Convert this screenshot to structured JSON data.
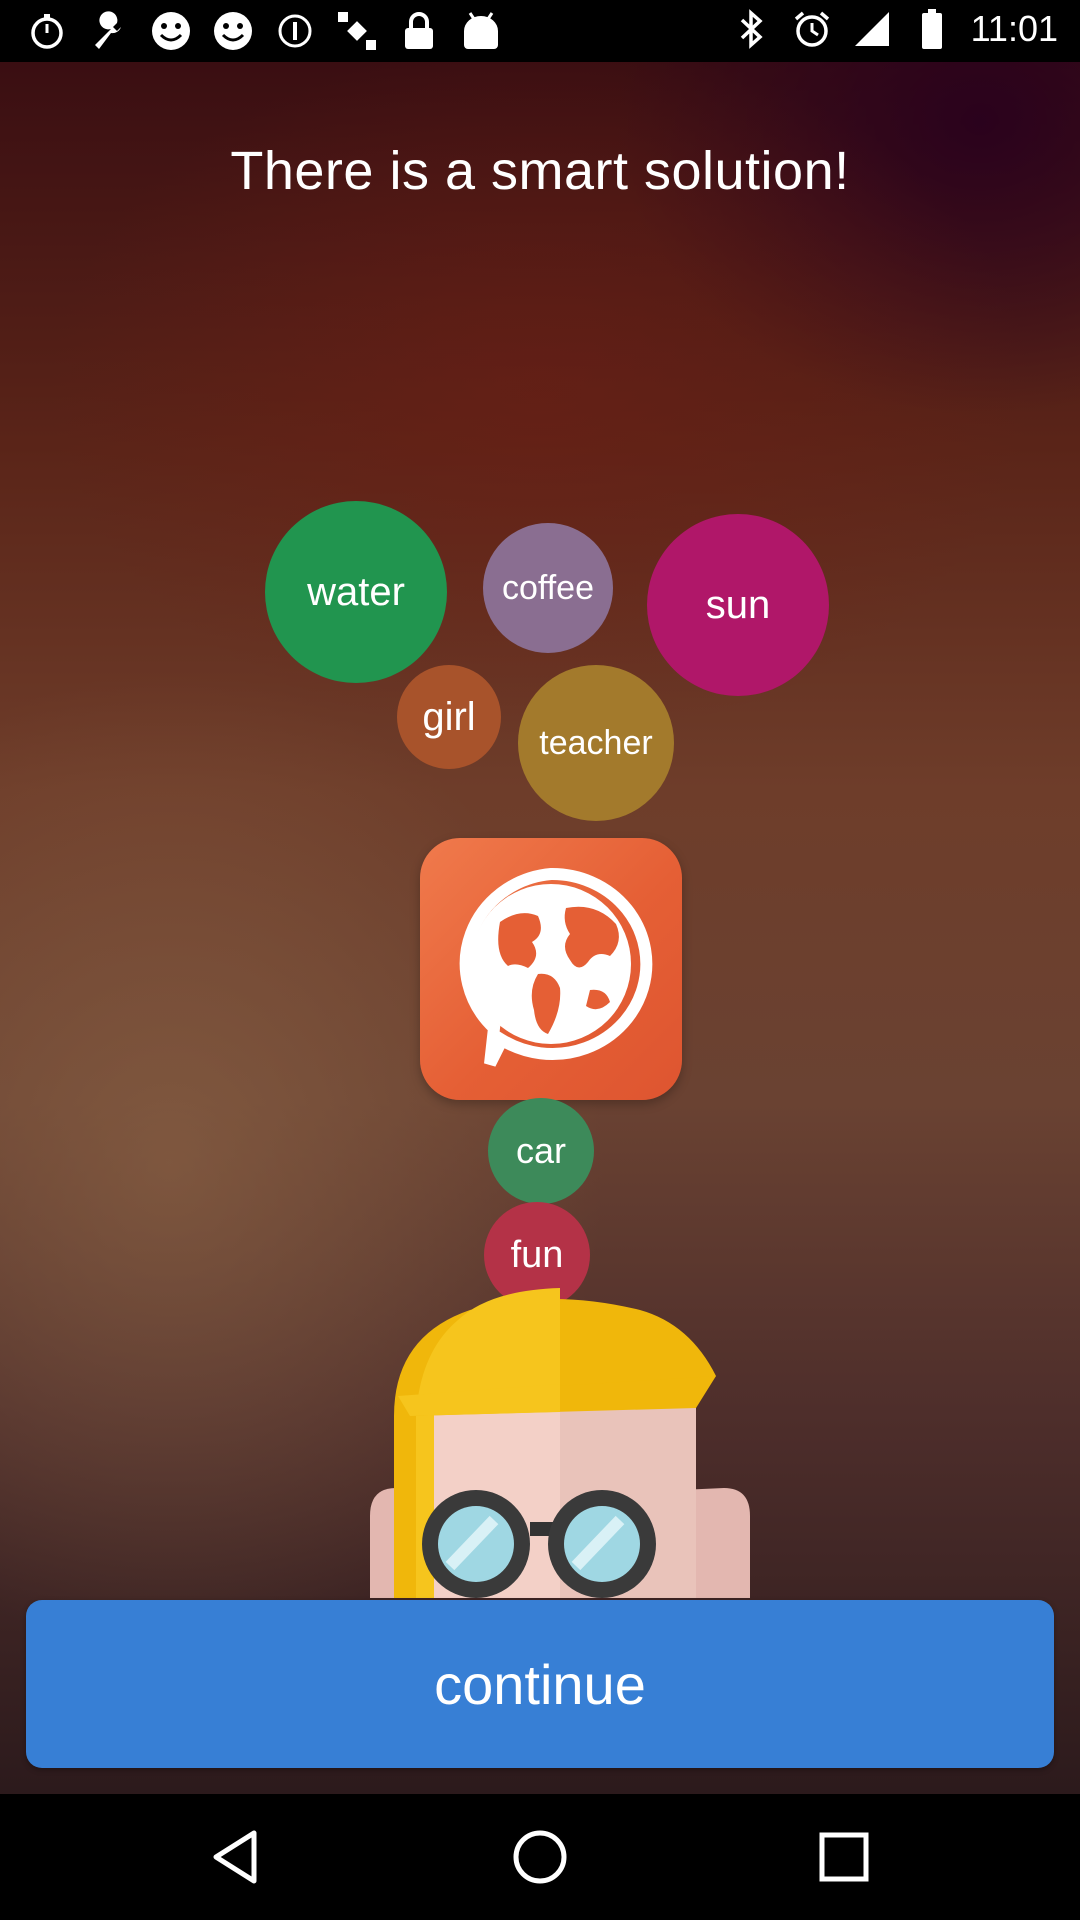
{
  "status_bar": {
    "time": "11:01",
    "left_icons": [
      "stopwatch-icon",
      "wrench-icon",
      "smiley-icon",
      "smiley-icon",
      "info-icon",
      "satellite-icon",
      "lock-icon",
      "android-icon"
    ],
    "right_icons": [
      "bluetooth-icon",
      "alarm-icon",
      "signal-icon",
      "battery-icon"
    ]
  },
  "screen": {
    "title": "There is a smart solution!",
    "bubbles": [
      {
        "label": "water",
        "color": "#21954f"
      },
      {
        "label": "coffee",
        "color": "#8a6e91"
      },
      {
        "label": "sun",
        "color": "#b01769"
      },
      {
        "label": "girl",
        "color": "#a8532b"
      },
      {
        "label": "teacher",
        "color": "#a37a2c"
      },
      {
        "label": "car",
        "color": "#3d8a5a"
      },
      {
        "label": "fun",
        "color": "#b43247"
      }
    ],
    "app_icon": "globe-chat-icon",
    "character": "nerd-character"
  },
  "continue_button": {
    "label": "continue",
    "color": "#377fd5"
  },
  "nav_bar": {
    "buttons": [
      "back-icon",
      "home-icon",
      "recents-icon"
    ]
  }
}
